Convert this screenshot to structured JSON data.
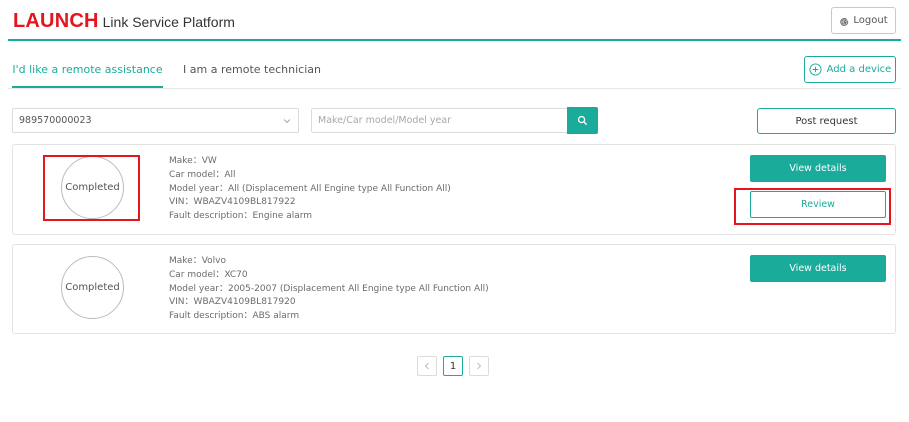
{
  "header": {
    "brand": "LAUNCH",
    "platform_name": "Link Service Platform",
    "logout_label": "Logout"
  },
  "tabs": [
    {
      "label": "I'd like a remote assistance",
      "active": true
    },
    {
      "label": "I am a remote technician",
      "active": false
    }
  ],
  "toolbar": {
    "add_device_label": "Add a device",
    "device_selected": "989570000023",
    "search_placeholder": "Make/Car model/Model year",
    "post_request_label": "Post request"
  },
  "requests": [
    {
      "status": "Completed",
      "make": "Make：VW",
      "car_model": "Car model：All",
      "model_year": "Model year：All (Displacement All Engine type All Function All)",
      "vin": "VIN：WBAZV4109BL817922",
      "fault": "Fault description：Engine alarm",
      "view_label": "View details",
      "review_label": "Review"
    },
    {
      "status": "Completed",
      "make": "Make：Volvo",
      "car_model": "Car model：XC70",
      "model_year": "Model year：2005-2007 (Displacement All Engine type All Function All)",
      "vin": "VIN：WBAZV4109BL817920",
      "fault": "Fault description：ABS alarm",
      "view_label": "View details"
    }
  ],
  "pagination": {
    "current_page": "1"
  },
  "colors": {
    "accent": "#1aab9b",
    "brand": "#e4151f",
    "highlight": "#e4151f"
  }
}
